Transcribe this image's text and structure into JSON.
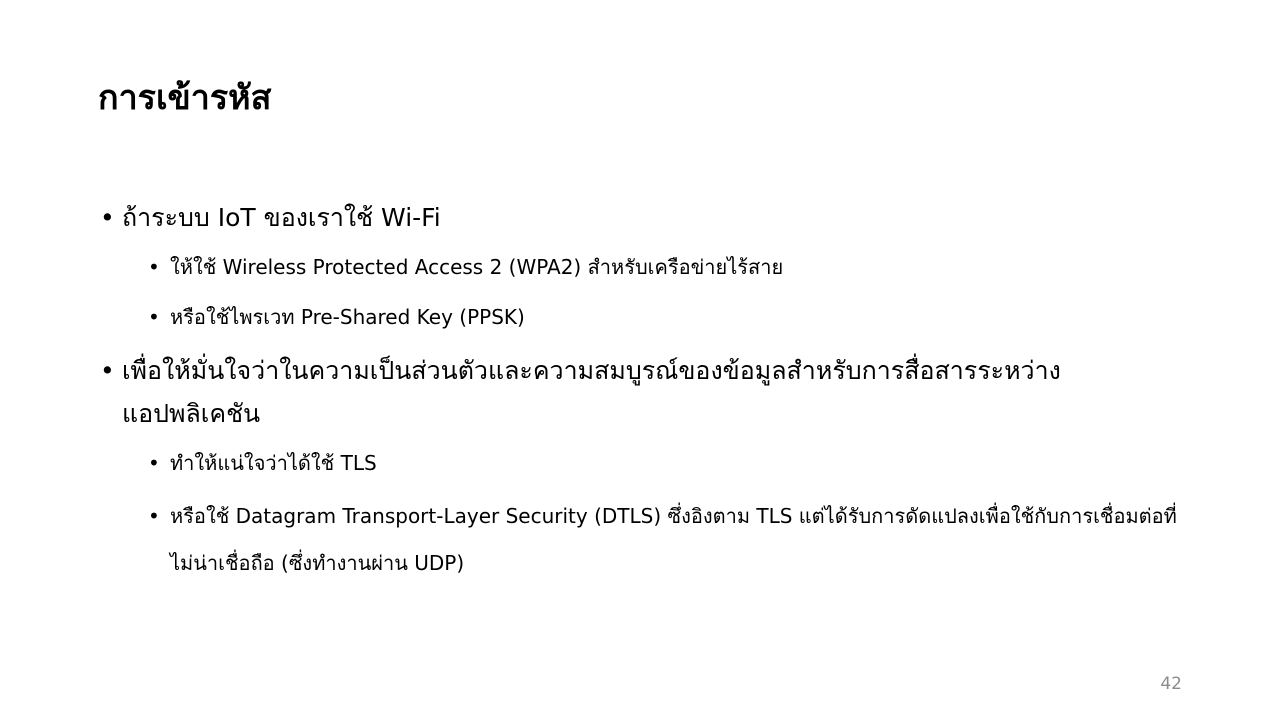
{
  "slide": {
    "title": "การเข้ารหัส",
    "bullet_char": "•",
    "items": [
      {
        "text": "ถ้าระบบ IoT ของเราใช้ Wi-Fi",
        "subitems": [
          "ให้ใช้ Wireless Protected Access 2 (WPA2) สำหรับเครือข่ายไร้สาย",
          "หรือใช้ไพรเวท Pre-Shared Key (PPSK)"
        ]
      },
      {
        "text": "เพื่อให้มั่นใจว่าในความเป็นส่วนตัวและความสมบูรณ์ของข้อมูลสำหรับการสื่อสารระหว่างแอปพลิเคชัน",
        "subitems": [
          "ทำให้แน่ใจว่าได้ใช้ TLS",
          "หรือใช้ Datagram Transport-Layer Security (DTLS) ซึ่งอิงตาม TLS แต่ได้รับการดัดแปลงเพื่อใช้กับการเชื่อมต่อที่ไม่น่าเชื่อถือ (ซึ่งทำงานผ่าน UDP)"
        ]
      }
    ],
    "page_number": "42"
  }
}
